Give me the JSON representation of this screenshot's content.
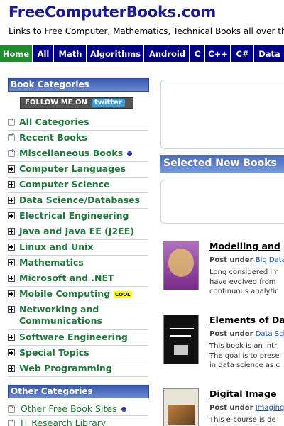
{
  "header": {
    "site_title": "FreeComputerBooks.com",
    "tagline": "Links to Free Computer, Mathematics, Technical Books all over the"
  },
  "nav": {
    "items": [
      "Home",
      "All",
      "Math",
      "Algorithms",
      "Android",
      "C",
      "C++",
      "C#",
      "Data"
    ],
    "active": "Home"
  },
  "sidebar": {
    "book_categories_title": "Book Categories",
    "twitter_button": {
      "text": "FOLLOW ME ON",
      "brand": "twitter"
    },
    "categories": [
      "All Categories",
      "Recent Books",
      "Miscellaneous Books",
      "Computer Languages",
      "Computer Science",
      "Data Science/Databases",
      "Electrical Engineering",
      "Java and Java EE (J2EE)",
      "Linux and Unix",
      "Mathematics",
      "Microsoft and .NET",
      "Mobile Computing",
      "Networking and",
      "Communications",
      "Software Engineering",
      "Special Topics",
      "Web Programming"
    ],
    "cool_badge": "COOL",
    "other_categories_title": "Other Categories",
    "other_categories": [
      "Other Free Book Sites",
      "IT Research Library"
    ]
  },
  "main": {
    "section_title": "Selected New Books",
    "posted_under_label": "Post under",
    "books": [
      {
        "title": "Modelling and",
        "category": "Big Data",
        "desc": [
          "Long considered im",
          "have evolved from",
          "continuous analytic"
        ],
        "cover_color": "#7a2a8a"
      },
      {
        "title": "Elements of Da",
        "category": "Data Scie",
        "desc": [
          "This book is an intr",
          "The goal is to prese",
          "in data science as c"
        ],
        "cover_color": "#111111"
      },
      {
        "title": "Digital Image",
        "category": "Imaging F",
        "desc": [
          "This e-course is de"
        ],
        "cover_color": "#e8e4d8"
      }
    ]
  },
  "colors": {
    "nav_bg": "#00008b",
    "nav_active": "#1c8c2c",
    "category_green": "#1d7a3a",
    "title_blue": "#1a1a99"
  }
}
